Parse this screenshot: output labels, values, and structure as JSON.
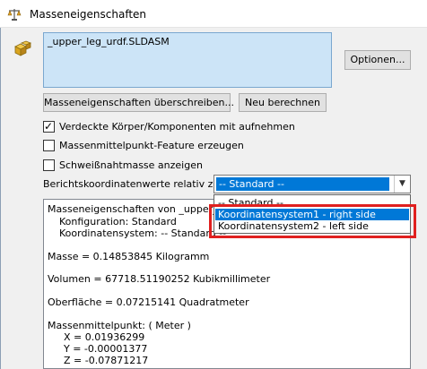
{
  "window": {
    "title": "Masseneigenschaften"
  },
  "selection_list": {
    "items": [
      "_upper_leg_urdf.SLDASM"
    ]
  },
  "buttons": {
    "options": "Optionen...",
    "override": "Masseneigenschaften überschreiben...",
    "recalculate": "Neu berechnen"
  },
  "checkboxes": [
    {
      "label": "Verdeckte Körper/Komponenten mit aufnehmen",
      "checked": true
    },
    {
      "label": "Massenmittelpunkt-Feature erzeugen",
      "checked": false
    },
    {
      "label": "Schweißnahtmasse anzeigen",
      "checked": false
    }
  ],
  "coordinate_system": {
    "label": "Berichtskoordinatenwerte relativ zu:",
    "selected": "-- Standard --",
    "options": [
      "-- Standard --",
      "Koordinatensystem1 - right side",
      "Koordinatensystem2 - left side"
    ],
    "highlighted_index": 1
  },
  "report": {
    "header_line": "Masseneigenschaften von _upper_l",
    "configuration": "Konfiguration: Standard",
    "coord_system": "Koordinatensystem: -- Standard --",
    "mass": "Masse = 0.14853845 Kilogramm",
    "volume": "Volumen = 67718.51190252 Kubikmillimeter",
    "surface": "Oberfläche = 0.07215141 Quadratmeter",
    "com_title": "Massenmittelpunkt: ( Meter )",
    "com_x": "X = 0.01936299",
    "com_y": "Y = -0.00001377",
    "com_z": "Z = -0.07871217"
  },
  "colors": {
    "selection_bg": "#cce4f7",
    "highlight": "#0078d7",
    "annotation_box": "#e0201f"
  }
}
